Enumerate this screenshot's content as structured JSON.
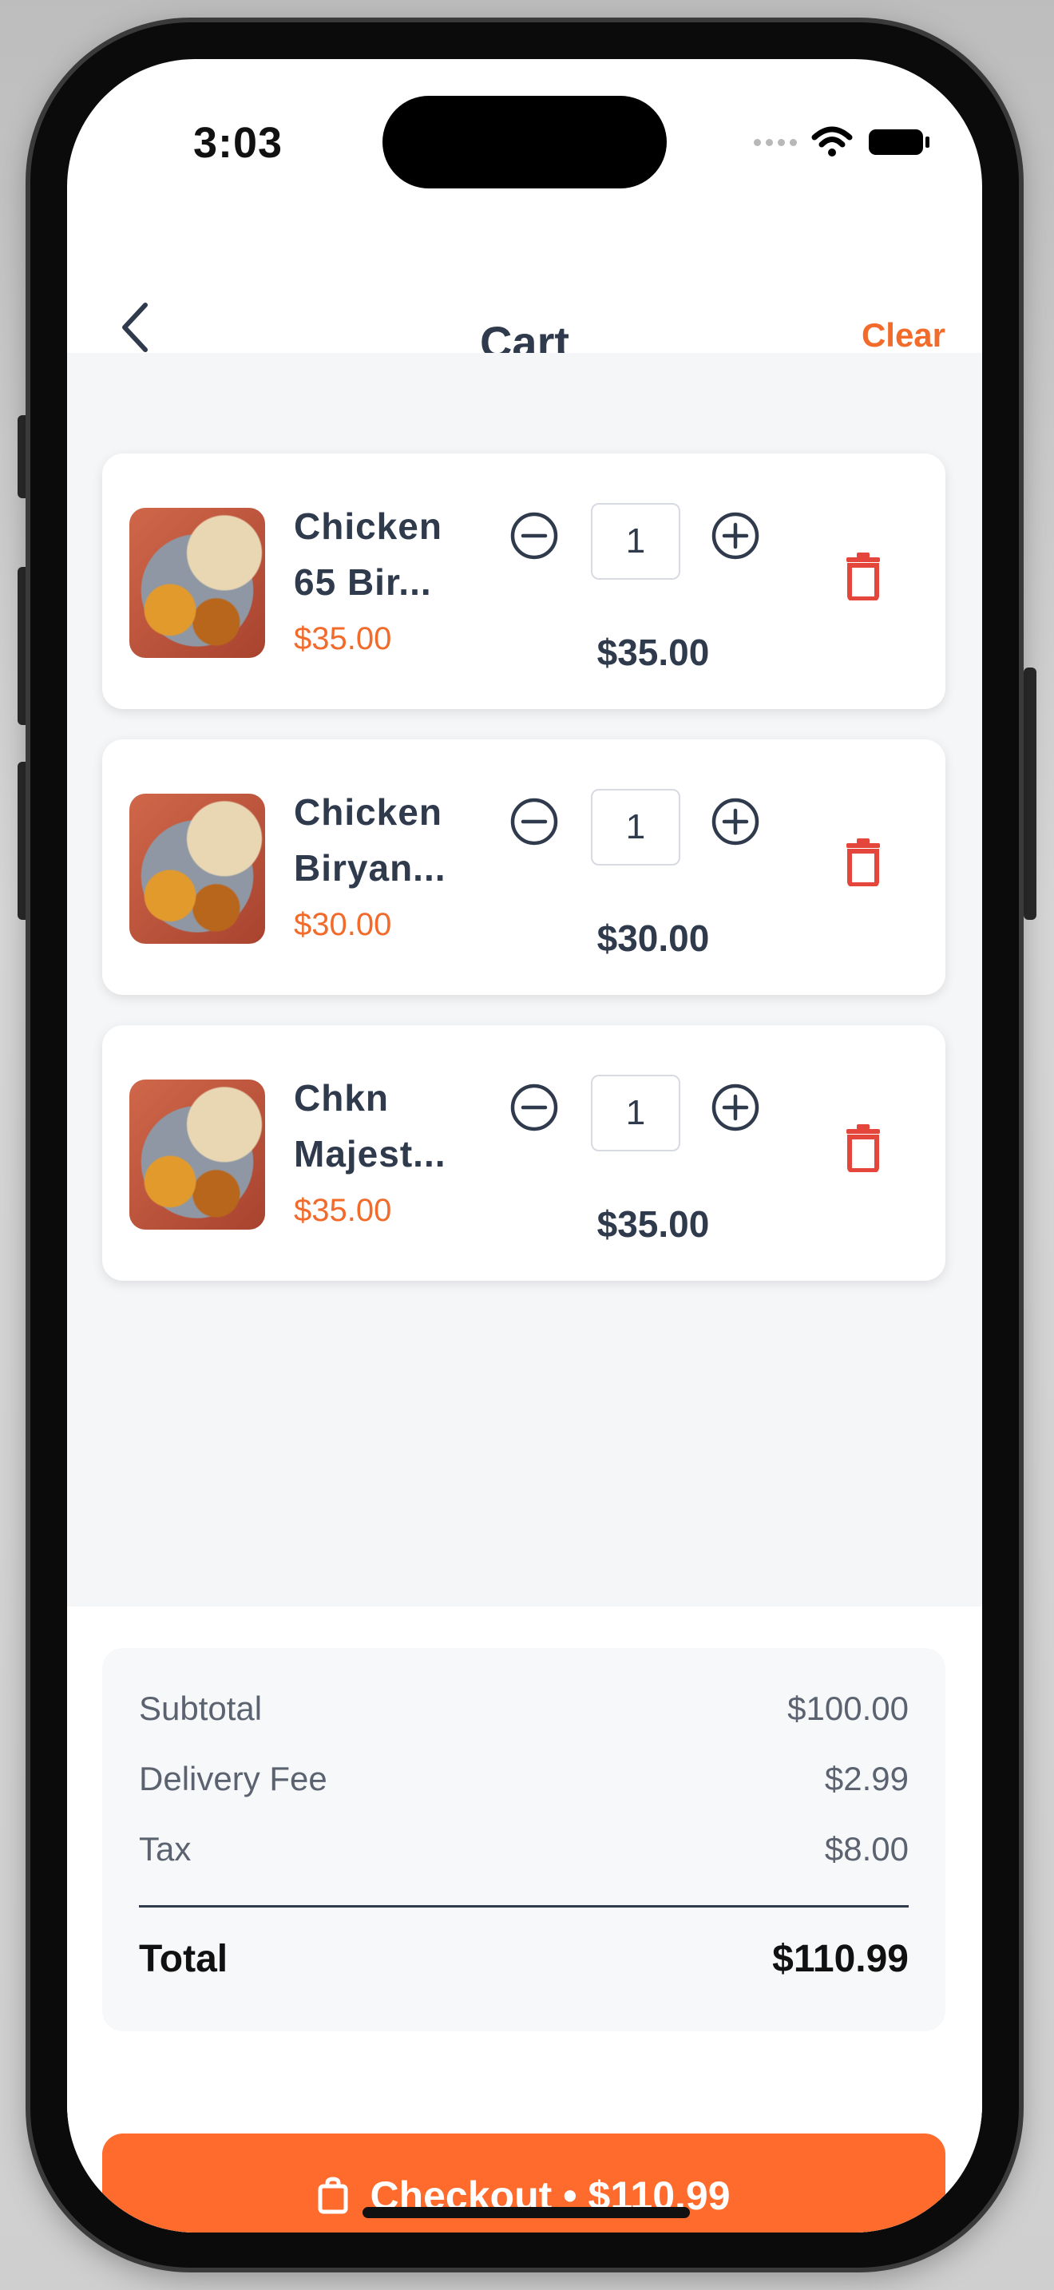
{
  "status_bar": {
    "time": "3:03"
  },
  "header": {
    "title": "Cart",
    "clear_label": "Clear"
  },
  "cart": {
    "items": [
      {
        "name": "Chicken 65 Bir...",
        "unit_price": "$35.00",
        "quantity": "1",
        "line_total": "$35.00"
      },
      {
        "name": "Chicken Biryan...",
        "unit_price": "$30.00",
        "quantity": "1",
        "line_total": "$30.00"
      },
      {
        "name": "Chkn Majest...",
        "unit_price": "$35.00",
        "quantity": "1",
        "line_total": "$35.00"
      }
    ]
  },
  "summary": {
    "subtotal_label": "Subtotal",
    "subtotal_value": "$100.00",
    "delivery_label": "Delivery Fee",
    "delivery_value": "$2.99",
    "tax_label": "Tax",
    "tax_value": "$8.00",
    "total_label": "Total",
    "total_value": "$110.99"
  },
  "checkout": {
    "label": "Checkout • $110.99"
  },
  "icons": {
    "back": "chevron-left-icon",
    "minus": "minus-circle-icon",
    "plus": "plus-circle-icon",
    "delete": "trash-icon",
    "checkout": "shopping-bag-icon",
    "wifi": "wifi-icon",
    "battery": "battery-icon"
  },
  "colors": {
    "accent": "#ff6b2c",
    "accent_text": "#f26b2b",
    "delete": "#e5463b",
    "text_dark": "#2f3a4c",
    "background": "#f5f6f8"
  }
}
